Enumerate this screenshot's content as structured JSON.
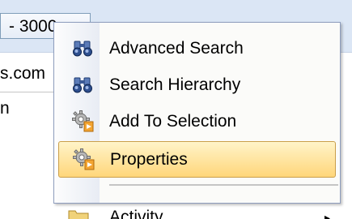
{
  "background": {
    "tab_text": "- 3000",
    "list_items": [
      "s.com",
      "n"
    ]
  },
  "context_menu": {
    "items": [
      {
        "label": "Advanced Search",
        "icon": "binoculars-icon"
      },
      {
        "label": "Search Hierarchy",
        "icon": "binoculars-icon"
      },
      {
        "label": "Add To Selection",
        "icon": "gear-add-icon"
      },
      {
        "label": "Properties",
        "icon": "gear-properties-icon",
        "highlighted": true
      }
    ],
    "partial_item": {
      "label": "Activity",
      "icon": "folder-icon",
      "has_submenu": true,
      "submenu_arrow": "▸"
    }
  },
  "colors": {
    "menu_background": "#fbfbf9",
    "highlight_top": "#fff4c9",
    "highlight_bottom": "#ffd67a",
    "highlight_border": "#ca9f4b",
    "menu_border": "#8e9dbd"
  }
}
